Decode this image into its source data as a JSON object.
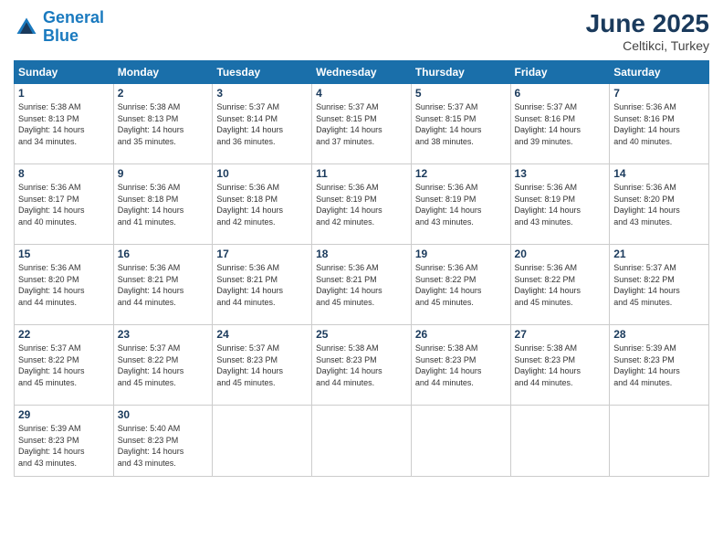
{
  "logo": {
    "line1": "General",
    "line2": "Blue"
  },
  "title": "June 2025",
  "subtitle": "Celtikci, Turkey",
  "header_days": [
    "Sunday",
    "Monday",
    "Tuesday",
    "Wednesday",
    "Thursday",
    "Friday",
    "Saturday"
  ],
  "weeks": [
    [
      {
        "day": "1",
        "info": "Sunrise: 5:38 AM\nSunset: 8:13 PM\nDaylight: 14 hours\nand 34 minutes."
      },
      {
        "day": "2",
        "info": "Sunrise: 5:38 AM\nSunset: 8:13 PM\nDaylight: 14 hours\nand 35 minutes."
      },
      {
        "day": "3",
        "info": "Sunrise: 5:37 AM\nSunset: 8:14 PM\nDaylight: 14 hours\nand 36 minutes."
      },
      {
        "day": "4",
        "info": "Sunrise: 5:37 AM\nSunset: 8:15 PM\nDaylight: 14 hours\nand 37 minutes."
      },
      {
        "day": "5",
        "info": "Sunrise: 5:37 AM\nSunset: 8:15 PM\nDaylight: 14 hours\nand 38 minutes."
      },
      {
        "day": "6",
        "info": "Sunrise: 5:37 AM\nSunset: 8:16 PM\nDaylight: 14 hours\nand 39 minutes."
      },
      {
        "day": "7",
        "info": "Sunrise: 5:36 AM\nSunset: 8:16 PM\nDaylight: 14 hours\nand 40 minutes."
      }
    ],
    [
      {
        "day": "8",
        "info": "Sunrise: 5:36 AM\nSunset: 8:17 PM\nDaylight: 14 hours\nand 40 minutes."
      },
      {
        "day": "9",
        "info": "Sunrise: 5:36 AM\nSunset: 8:18 PM\nDaylight: 14 hours\nand 41 minutes."
      },
      {
        "day": "10",
        "info": "Sunrise: 5:36 AM\nSunset: 8:18 PM\nDaylight: 14 hours\nand 42 minutes."
      },
      {
        "day": "11",
        "info": "Sunrise: 5:36 AM\nSunset: 8:19 PM\nDaylight: 14 hours\nand 42 minutes."
      },
      {
        "day": "12",
        "info": "Sunrise: 5:36 AM\nSunset: 8:19 PM\nDaylight: 14 hours\nand 43 minutes."
      },
      {
        "day": "13",
        "info": "Sunrise: 5:36 AM\nSunset: 8:19 PM\nDaylight: 14 hours\nand 43 minutes."
      },
      {
        "day": "14",
        "info": "Sunrise: 5:36 AM\nSunset: 8:20 PM\nDaylight: 14 hours\nand 43 minutes."
      }
    ],
    [
      {
        "day": "15",
        "info": "Sunrise: 5:36 AM\nSunset: 8:20 PM\nDaylight: 14 hours\nand 44 minutes."
      },
      {
        "day": "16",
        "info": "Sunrise: 5:36 AM\nSunset: 8:21 PM\nDaylight: 14 hours\nand 44 minutes."
      },
      {
        "day": "17",
        "info": "Sunrise: 5:36 AM\nSunset: 8:21 PM\nDaylight: 14 hours\nand 44 minutes."
      },
      {
        "day": "18",
        "info": "Sunrise: 5:36 AM\nSunset: 8:21 PM\nDaylight: 14 hours\nand 45 minutes."
      },
      {
        "day": "19",
        "info": "Sunrise: 5:36 AM\nSunset: 8:22 PM\nDaylight: 14 hours\nand 45 minutes."
      },
      {
        "day": "20",
        "info": "Sunrise: 5:36 AM\nSunset: 8:22 PM\nDaylight: 14 hours\nand 45 minutes."
      },
      {
        "day": "21",
        "info": "Sunrise: 5:37 AM\nSunset: 8:22 PM\nDaylight: 14 hours\nand 45 minutes."
      }
    ],
    [
      {
        "day": "22",
        "info": "Sunrise: 5:37 AM\nSunset: 8:22 PM\nDaylight: 14 hours\nand 45 minutes."
      },
      {
        "day": "23",
        "info": "Sunrise: 5:37 AM\nSunset: 8:22 PM\nDaylight: 14 hours\nand 45 minutes."
      },
      {
        "day": "24",
        "info": "Sunrise: 5:37 AM\nSunset: 8:23 PM\nDaylight: 14 hours\nand 45 minutes."
      },
      {
        "day": "25",
        "info": "Sunrise: 5:38 AM\nSunset: 8:23 PM\nDaylight: 14 hours\nand 44 minutes."
      },
      {
        "day": "26",
        "info": "Sunrise: 5:38 AM\nSunset: 8:23 PM\nDaylight: 14 hours\nand 44 minutes."
      },
      {
        "day": "27",
        "info": "Sunrise: 5:38 AM\nSunset: 8:23 PM\nDaylight: 14 hours\nand 44 minutes."
      },
      {
        "day": "28",
        "info": "Sunrise: 5:39 AM\nSunset: 8:23 PM\nDaylight: 14 hours\nand 44 minutes."
      }
    ],
    [
      {
        "day": "29",
        "info": "Sunrise: 5:39 AM\nSunset: 8:23 PM\nDaylight: 14 hours\nand 43 minutes."
      },
      {
        "day": "30",
        "info": "Sunrise: 5:40 AM\nSunset: 8:23 PM\nDaylight: 14 hours\nand 43 minutes."
      },
      {
        "day": "",
        "info": ""
      },
      {
        "day": "",
        "info": ""
      },
      {
        "day": "",
        "info": ""
      },
      {
        "day": "",
        "info": ""
      },
      {
        "day": "",
        "info": ""
      }
    ]
  ]
}
